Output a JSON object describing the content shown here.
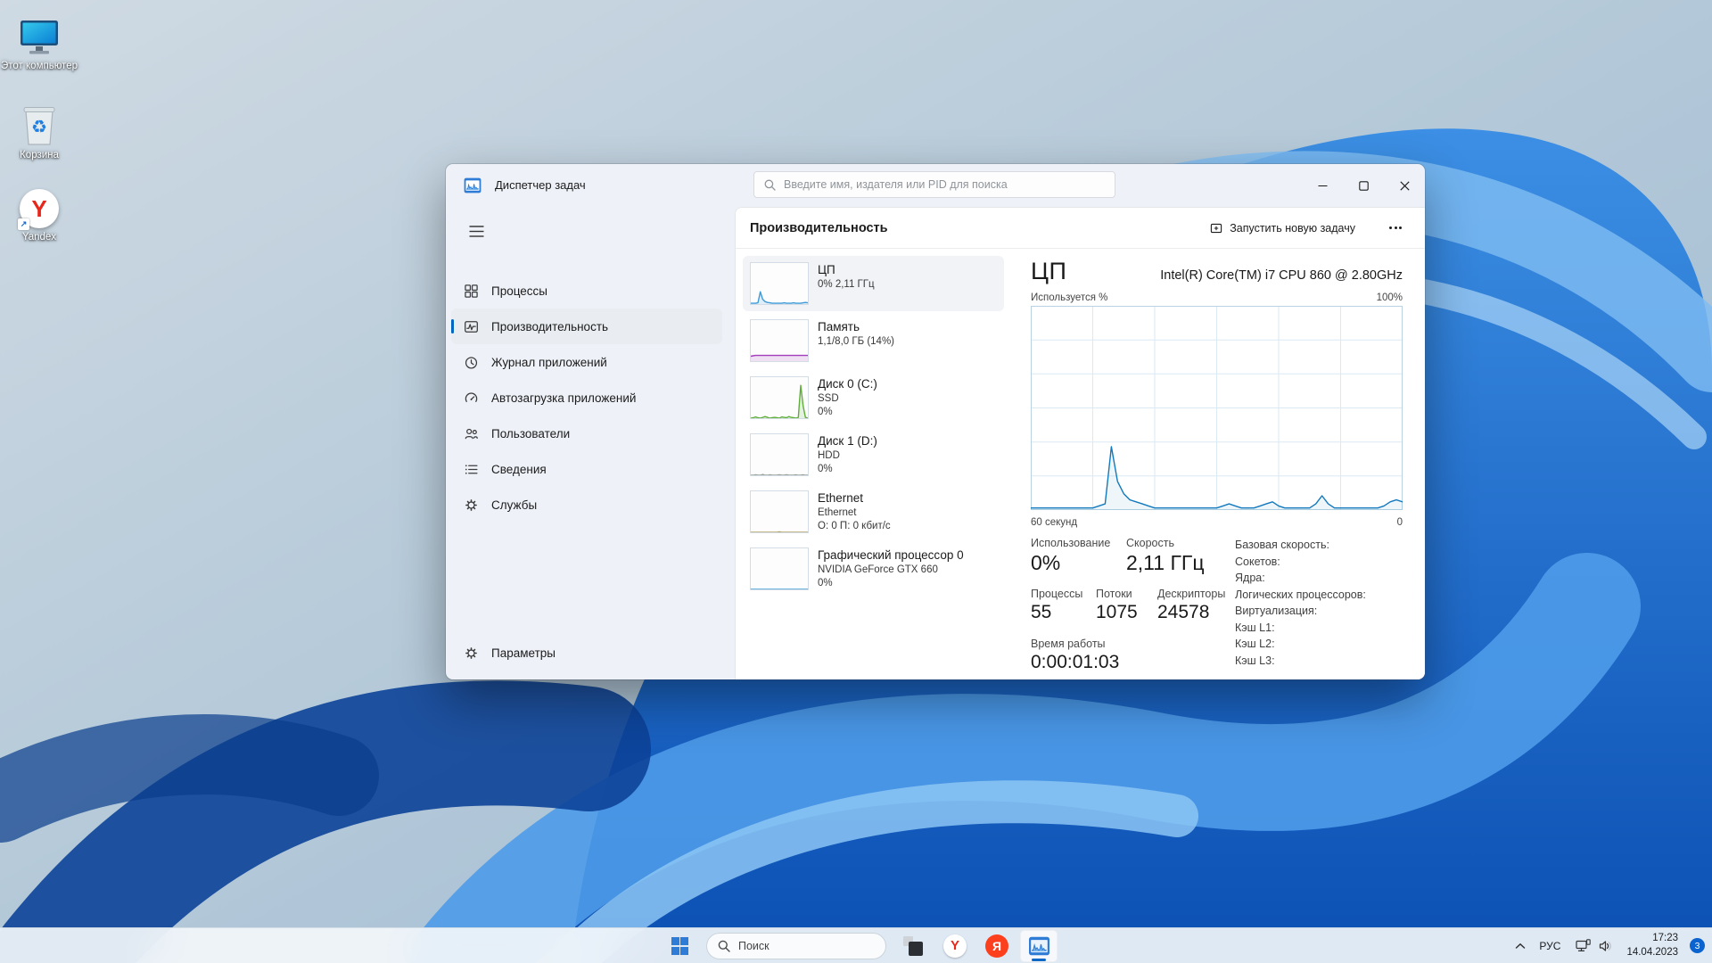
{
  "desktop": {
    "icons": [
      {
        "label": "Этот компьютер"
      },
      {
        "label": "Корзина"
      },
      {
        "label": "Yandex"
      }
    ]
  },
  "window": {
    "title": "Диспетчер задач",
    "search_placeholder": "Введите имя, издателя или PID для поиска",
    "sidebar": {
      "items": [
        {
          "label": "Процессы"
        },
        {
          "label": "Производительность"
        },
        {
          "label": "Журнал приложений"
        },
        {
          "label": "Автозагрузка приложений"
        },
        {
          "label": "Пользователи"
        },
        {
          "label": "Сведения"
        },
        {
          "label": "Службы"
        }
      ],
      "settings_label": "Параметры"
    },
    "header": {
      "title": "Производительность",
      "run_task_label": "Запустить новую задачу"
    },
    "perf_list": [
      {
        "title": "ЦП",
        "line1": "0% 2,11 ГГц",
        "line2": "",
        "spark_color": "#3f9bd8",
        "spark": [
          2,
          2,
          2,
          3,
          30,
          12,
          6,
          4,
          3,
          2,
          2,
          2,
          2,
          2,
          3,
          2,
          2,
          2,
          3,
          2,
          2,
          2,
          3,
          4,
          3
        ]
      },
      {
        "title": "Память",
        "line1": "1,1/8,0 ГБ (14%)",
        "line2": "",
        "spark_color": "#a13dbb",
        "spark": [
          12,
          13,
          14,
          14,
          14,
          14,
          14,
          14,
          14,
          14,
          14,
          14,
          14,
          14,
          14,
          14,
          14,
          14,
          14,
          14,
          14,
          14,
          14,
          14,
          14
        ]
      },
      {
        "title": "Диск 0 (C:)",
        "line1": "SSD",
        "line2": "0%",
        "spark_color": "#5fae3a",
        "spark": [
          0,
          1,
          3,
          1,
          0,
          2,
          4,
          2,
          0,
          1,
          2,
          1,
          0,
          3,
          2,
          1,
          4,
          2,
          1,
          0,
          2,
          80,
          30,
          2,
          0
        ]
      },
      {
        "title": "Диск 1 (D:)",
        "line1": "HDD",
        "line2": "0%",
        "spark_color": "#98a29a",
        "spark": [
          0,
          0,
          1,
          0,
          0,
          2,
          0,
          0,
          1,
          0,
          0,
          0,
          1,
          0,
          0,
          1,
          0,
          0,
          0,
          1,
          0,
          0,
          1,
          0,
          0
        ]
      },
      {
        "title": "Ethernet",
        "line1": "Ethernet",
        "line2": "О: 0 П: 0 кбит/с",
        "spark_color": "#b5a46a",
        "spark": [
          0,
          0,
          0,
          0,
          0,
          0,
          0,
          0,
          0,
          0,
          0,
          0,
          1,
          0,
          0,
          0,
          0,
          0,
          0,
          0,
          0,
          0,
          0,
          0,
          0
        ]
      },
      {
        "title": "Графический процессор 0",
        "line1": "NVIDIA GeForce GTX 660",
        "line2": "0%",
        "spark_color": "#3f9bd8",
        "spark": [
          0,
          0,
          0,
          0,
          0,
          0,
          0,
          0,
          0,
          0,
          0,
          0,
          0,
          0,
          0,
          0,
          0,
          0,
          0,
          0,
          0,
          0,
          0,
          0,
          0
        ]
      }
    ],
    "detail": {
      "title": "ЦП",
      "subtitle": "Intel(R) Core(TM) i7 CPU 860 @ 2.80GHz",
      "axis_top_left": "Используется %",
      "axis_top_right": "100%",
      "axis_bottom_left": "60 секунд",
      "axis_bottom_right": "0",
      "stats": {
        "usage_label": "Использование",
        "usage_value": "0%",
        "speed_label": "Скорость",
        "speed_value": "2,11 ГГц",
        "processes_label": "Процессы",
        "processes_value": "55",
        "threads_label": "Потоки",
        "threads_value": "1075",
        "handles_label": "Дескрипторы",
        "handles_value": "24578",
        "uptime_label": "Время работы",
        "uptime_value": "0:00:01:03"
      },
      "info_labels": [
        "Базовая скорость:",
        "Сокетов:",
        "Ядра:",
        "Логических процессоров:",
        "Виртуализация:",
        "Кэш L1:",
        "Кэш L2:",
        "Кэш L3:"
      ]
    }
  },
  "taskbar": {
    "search_label": "Поиск",
    "tray": {
      "lang": "РУС",
      "time": "17:23",
      "date": "14.04.2023",
      "badge": "3"
    }
  },
  "colors": {
    "accent": "#0067c0",
    "chart_line": "#1279bd",
    "chart_grid": "#dbe9f3",
    "chart_border": "#b9d2e4"
  },
  "chart_data": {
    "type": "area",
    "title": "ЦП — Используется %",
    "ylabel": "Используется %",
    "ylim": [
      0,
      100
    ],
    "xlabel_left": "60 секунд",
    "xlabel_right": "0",
    "legend": "none",
    "grid": {
      "columns": 6,
      "rows": 6
    },
    "series": [
      {
        "name": "ЦП",
        "values": [
          1,
          1,
          1,
          1,
          1,
          1,
          1,
          1,
          1,
          1,
          1,
          2,
          3,
          31,
          14,
          8,
          5,
          4,
          3,
          2,
          1,
          1,
          1,
          1,
          1,
          1,
          1,
          1,
          1,
          1,
          1,
          2,
          3,
          2,
          1,
          1,
          1,
          2,
          3,
          4,
          2,
          1,
          1,
          1,
          1,
          1,
          3,
          7,
          3,
          1,
          1,
          1,
          1,
          1,
          1,
          1,
          1,
          2,
          4,
          5,
          4
        ]
      }
    ]
  }
}
